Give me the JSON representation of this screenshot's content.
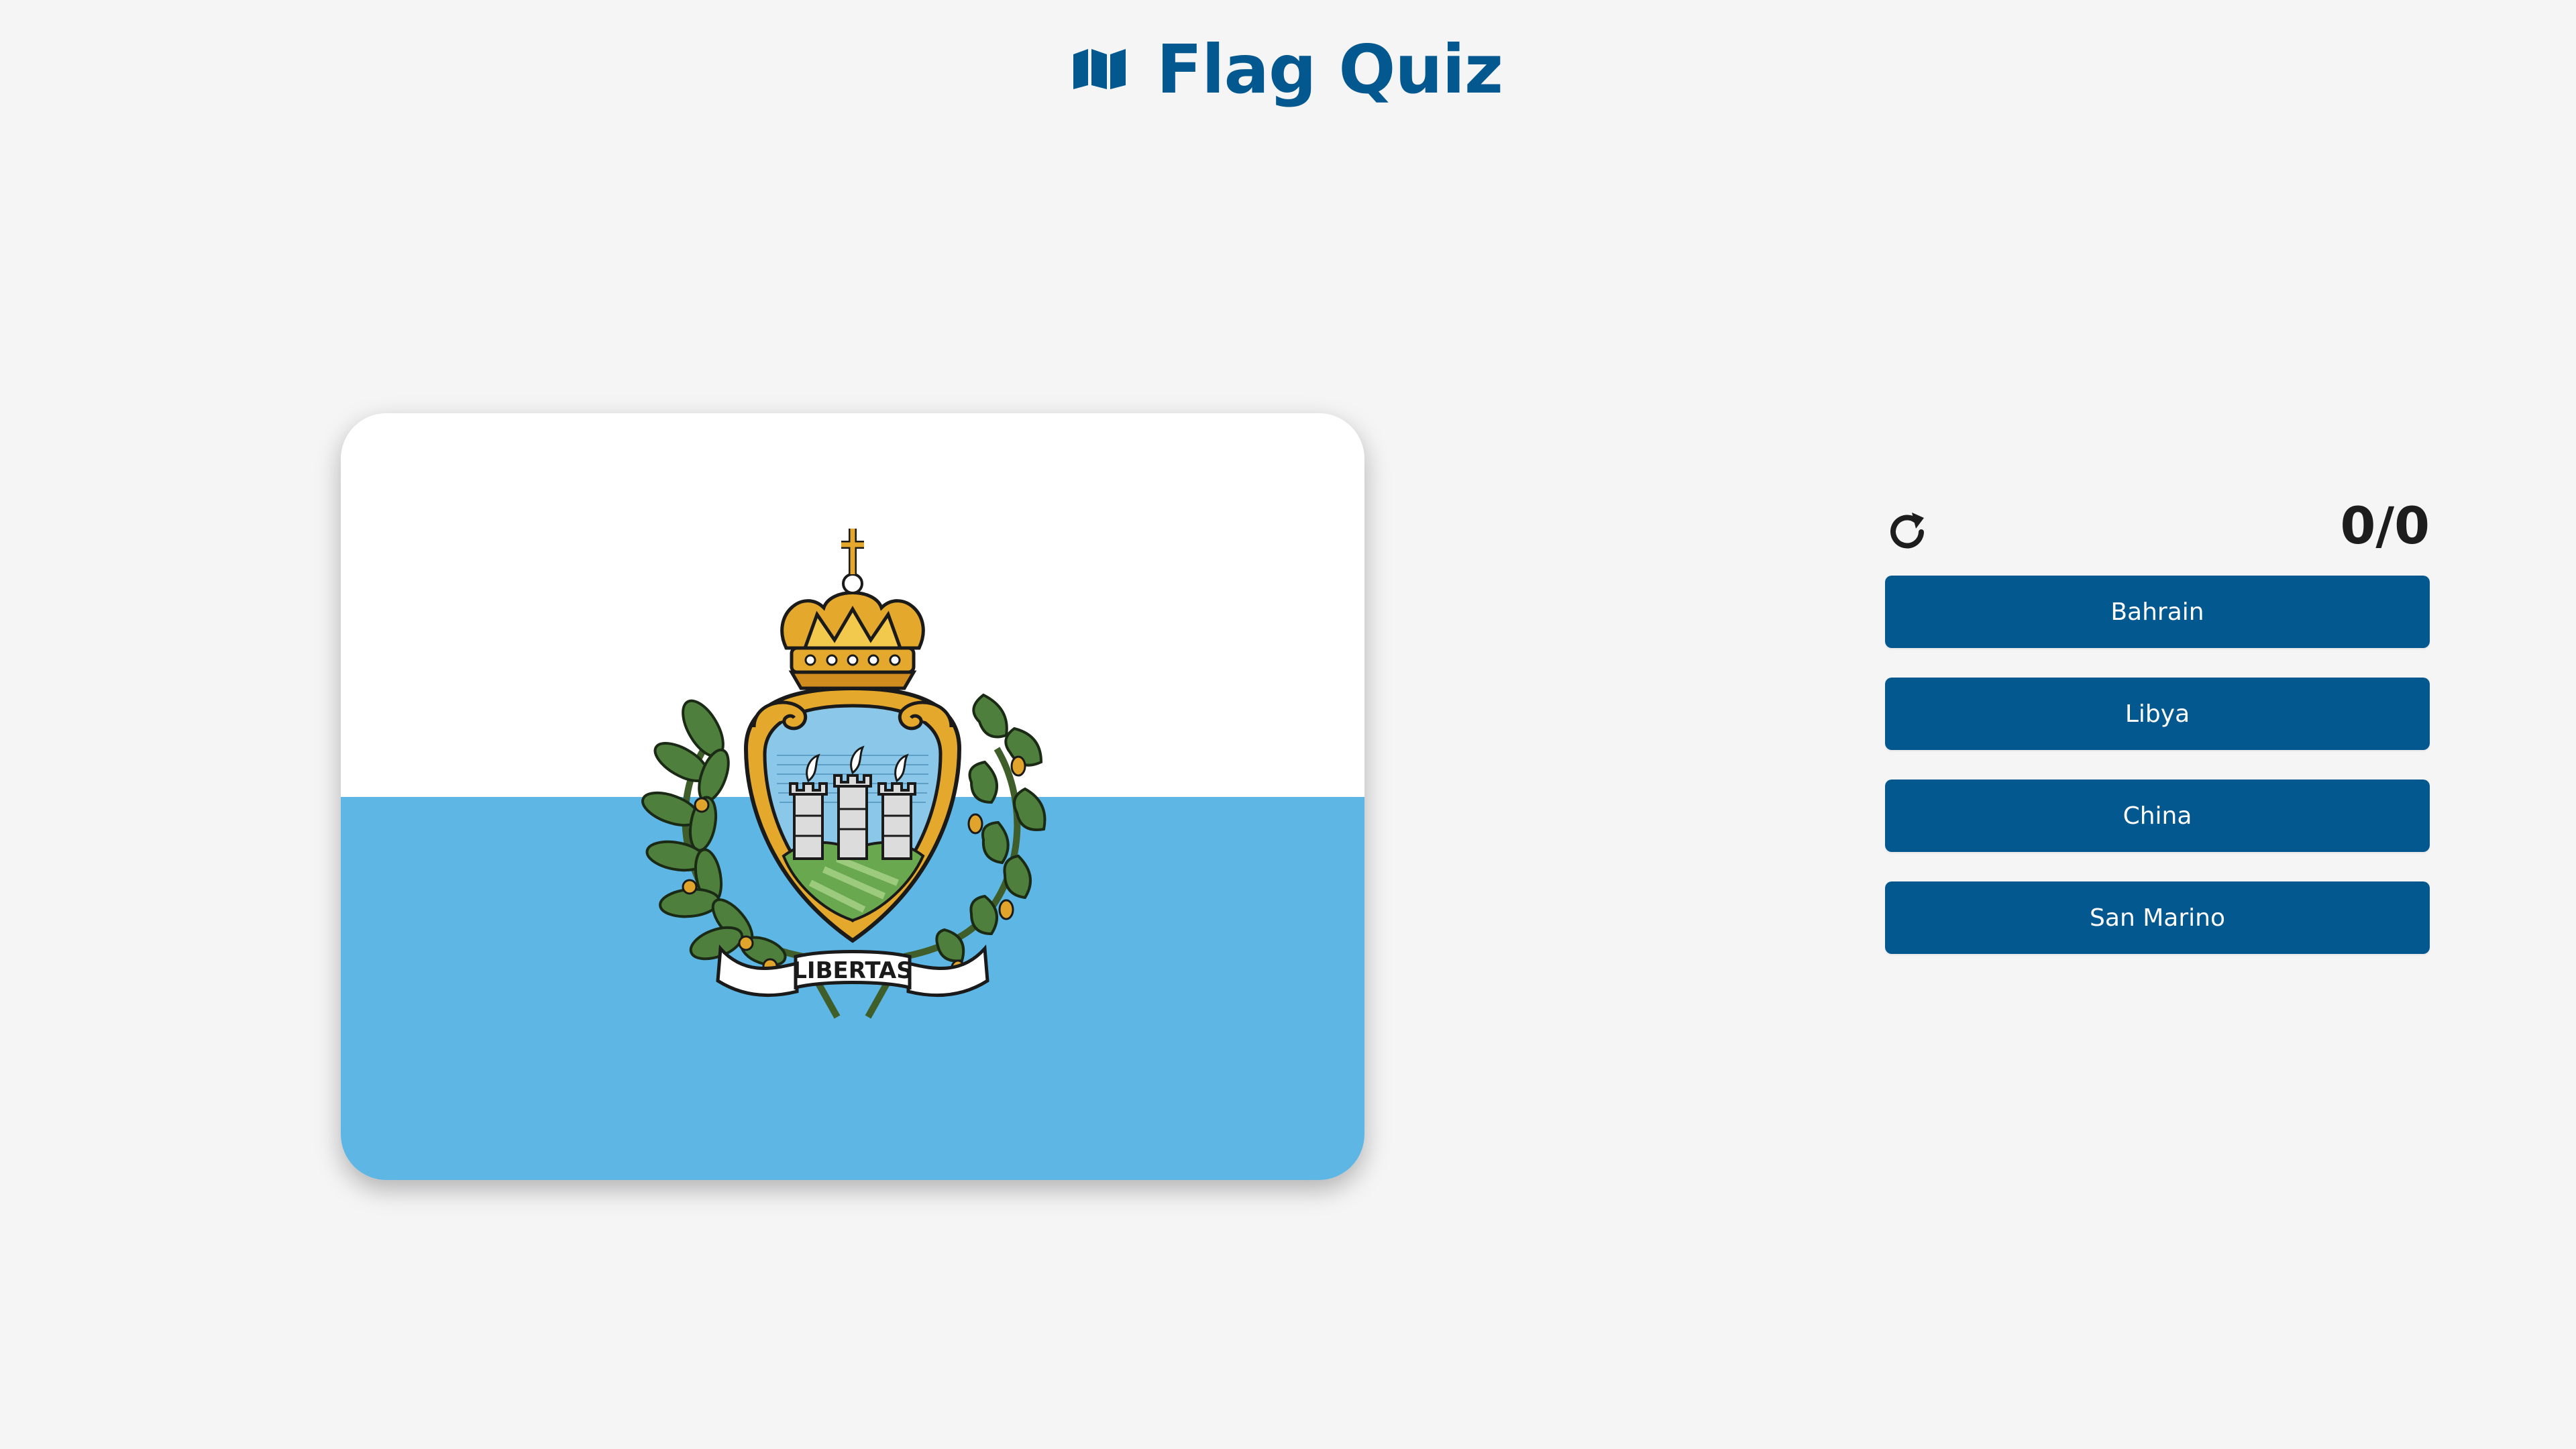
{
  "header": {
    "title": "Flag Quiz",
    "icon": "map-icon"
  },
  "flag": {
    "country": "San Marino",
    "motto": "LIBERTAS",
    "colors": {
      "top": "#ffffff",
      "bottom": "#5eb6e4"
    }
  },
  "quiz": {
    "restart_icon": "restart-icon",
    "score": "0/0",
    "options": [
      {
        "label": "Bahrain"
      },
      {
        "label": "Libya"
      },
      {
        "label": "China"
      },
      {
        "label": "San Marino"
      }
    ]
  },
  "theme": {
    "accent": "#02588f",
    "background": "#f5f5f6",
    "score_color": "#1d1d1d"
  }
}
